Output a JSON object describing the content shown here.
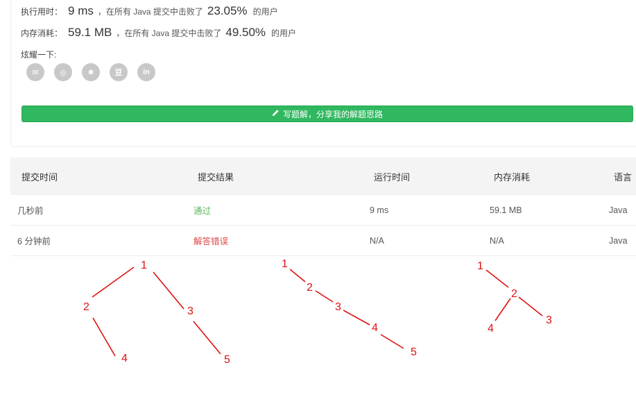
{
  "stats": {
    "runtime": {
      "label": "执行用时：",
      "value": "9 ms",
      "mid": "，在所有 Java 提交中击败了",
      "percent": "23.05%",
      "tail": "的用户"
    },
    "memory": {
      "label": "内存消耗：",
      "value": "59.1 MB",
      "mid": "，在所有 Java 提交中击败了",
      "percent": "49.50%",
      "tail": "的用户"
    }
  },
  "share": {
    "label": "炫耀一下:",
    "icons": [
      {
        "name": "wechat-icon",
        "glyph": "✉"
      },
      {
        "name": "weibo-icon",
        "glyph": "◎"
      },
      {
        "name": "qq-icon",
        "glyph": "☻"
      },
      {
        "name": "douban-icon",
        "glyph": "豆"
      },
      {
        "name": "linkedin-icon",
        "glyph": "in"
      }
    ]
  },
  "write_button": {
    "icon": "pencil-icon",
    "label": "写题解，分享我的解题思路"
  },
  "table": {
    "headers": [
      "提交时间",
      "提交结果",
      "运行时间",
      "内存消耗",
      "语言"
    ],
    "rows": [
      {
        "time": "几秒前",
        "result": "通过",
        "status": "ok",
        "runtime": "9 ms",
        "memory": "59.1 MB",
        "language": "Java"
      },
      {
        "time": "6 分钟前",
        "result": "解答错误",
        "status": "err",
        "runtime": "N/A",
        "memory": "N/A",
        "language": "Java"
      }
    ]
  },
  "colors": {
    "accent_green": "#2fb85f",
    "pass": "#5cb85c",
    "fail": "#e04848",
    "annotation": "#e01010"
  },
  "annotations": {
    "tree1": [
      "1",
      "2",
      "3",
      "4",
      "5"
    ],
    "tree2": [
      "1",
      "2",
      "3",
      "4",
      "5"
    ],
    "tree3": [
      "1",
      "2",
      "3",
      "4"
    ]
  }
}
